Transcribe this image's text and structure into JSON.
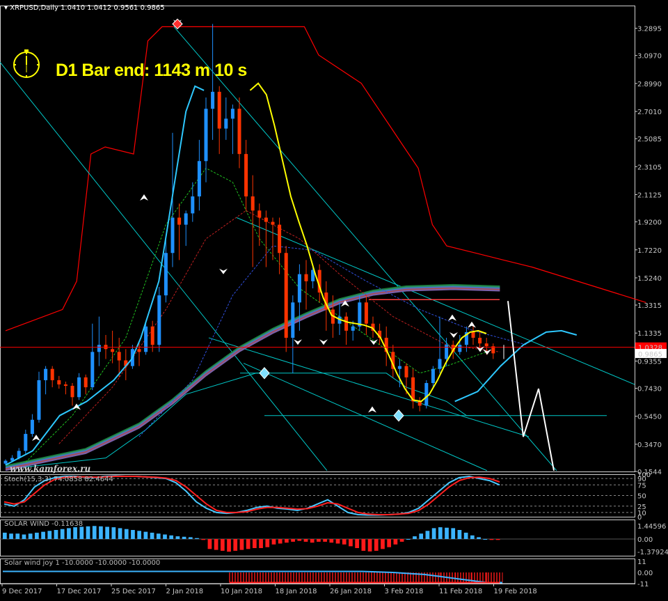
{
  "header": {
    "symbol": "XRPUSD,Daily",
    "ohlc": "1.0410 1.0412 0.9561 0.9865",
    "bar_timer": "D1 Bar end: 1143 m 10 s",
    "watermark": "www.kamforex.ru"
  },
  "colors": {
    "background": "#000000",
    "bull_candle": "#1e90ff",
    "bear_candle": "#ff3300",
    "ma_yellow": "#ffff00",
    "ma_cyan": "#2ec8ff",
    "envelope_red": "#ff0000",
    "trendline": "#00c8c8",
    "stoch_main": "#48c8ff",
    "stoch_signal": "#ff2020",
    "solar_pos": "#3cb4ff",
    "solar_neg": "#ff1a1a"
  },
  "chart_data": [
    {
      "type": "candlestick",
      "name": "price",
      "ylim": [
        0.1544,
        3.45
      ],
      "current_price_label": "1.0328",
      "bid_label": "0.9865",
      "y_ticks": [
        "3.2895",
        "3.0970",
        "2.8990",
        "2.7010",
        "2.5085",
        "2.3105",
        "2.1125",
        "1.9200",
        "1.7220",
        "1.5240",
        "1.3315",
        "1.1335",
        "0.9355",
        "0.7430",
        "0.5450",
        "0.3470",
        "0.1544"
      ],
      "x_ticks": [
        "9 Dec 2017",
        "17 Dec 2017",
        "25 Dec 2017",
        "2 Jan 2018",
        "10 Jan 2018",
        "18 Jan 2018",
        "26 Jan 2018",
        "3 Feb 2018",
        "11 Feb 2018",
        "19 Feb 2018"
      ],
      "candles": [
        [
          0.21,
          0.24,
          0.2,
          0.23
        ],
        [
          0.23,
          0.27,
          0.22,
          0.25
        ],
        [
          0.25,
          0.32,
          0.24,
          0.3
        ],
        [
          0.3,
          0.45,
          0.28,
          0.42
        ],
        [
          0.42,
          0.56,
          0.4,
          0.52
        ],
        [
          0.52,
          0.86,
          0.5,
          0.8
        ],
        [
          0.8,
          0.9,
          0.7,
          0.88
        ],
        [
          0.88,
          0.9,
          0.75,
          0.8
        ],
        [
          0.8,
          0.83,
          0.74,
          0.77
        ],
        [
          0.77,
          0.79,
          0.7,
          0.76
        ],
        [
          0.76,
          0.78,
          0.62,
          0.68
        ],
        [
          0.68,
          0.85,
          0.66,
          0.82
        ],
        [
          0.82,
          0.84,
          0.7,
          0.75
        ],
        [
          0.75,
          1.2,
          0.73,
          1.0
        ],
        [
          1.0,
          1.25,
          0.9,
          1.05
        ],
        [
          1.05,
          1.12,
          0.95,
          1.02
        ],
        [
          1.02,
          1.15,
          0.92,
          1.0
        ],
        [
          1.0,
          1.1,
          0.82,
          0.94
        ],
        [
          0.94,
          1.02,
          0.8,
          0.9
        ],
        [
          0.9,
          1.05,
          0.88,
          1.02
        ],
        [
          1.02,
          1.08,
          0.9,
          1.0
        ],
        [
          1.0,
          1.22,
          0.98,
          1.18
        ],
        [
          1.18,
          1.22,
          1.0,
          1.05
        ],
        [
          1.05,
          1.46,
          1.0,
          1.4
        ],
        [
          1.4,
          1.8,
          1.35,
          1.7
        ],
        [
          1.7,
          2.55,
          1.6,
          1.95
        ],
        [
          1.95,
          2.05,
          1.65,
          1.9
        ],
        [
          1.9,
          2.0,
          1.75,
          1.98
        ],
        [
          1.98,
          2.2,
          1.92,
          2.1
        ],
        [
          2.1,
          2.5,
          2.0,
          2.35
        ],
        [
          2.35,
          2.8,
          2.2,
          2.72
        ],
        [
          2.72,
          3.32,
          2.5,
          2.84
        ],
        [
          2.84,
          2.88,
          2.4,
          2.58
        ],
        [
          2.58,
          2.8,
          2.5,
          2.65
        ],
        [
          2.65,
          2.75,
          2.4,
          2.72
        ],
        [
          2.72,
          2.8,
          2.3,
          2.4
        ],
        [
          2.4,
          2.5,
          2.0,
          2.1
        ],
        [
          2.1,
          2.25,
          1.6,
          2.0
        ],
        [
          2.0,
          2.05,
          1.75,
          1.95
        ],
        [
          1.95,
          2.0,
          1.6,
          1.92
        ],
        [
          1.92,
          1.95,
          1.65,
          1.9
        ],
        [
          1.9,
          1.95,
          1.55,
          1.7
        ],
        [
          1.7,
          1.75,
          1.0,
          1.1
        ],
        [
          1.1,
          1.4,
          0.85,
          1.35
        ],
        [
          1.35,
          1.62,
          1.15,
          1.55
        ],
        [
          1.55,
          1.65,
          1.3,
          1.5
        ],
        [
          1.5,
          1.6,
          1.45,
          1.58
        ],
        [
          1.58,
          1.62,
          1.35,
          1.42
        ],
        [
          1.42,
          1.5,
          1.15,
          1.3
        ],
        [
          1.3,
          1.4,
          1.1,
          1.2
        ],
        [
          1.2,
          1.35,
          1.12,
          1.25
        ],
        [
          1.25,
          1.28,
          1.05,
          1.15
        ],
        [
          1.15,
          1.22,
          1.08,
          1.18
        ],
        [
          1.18,
          1.4,
          1.15,
          1.35
        ],
        [
          1.35,
          1.4,
          1.12,
          1.2
        ],
        [
          1.2,
          1.25,
          1.1,
          1.15
        ],
        [
          1.15,
          1.2,
          1.05,
          1.1
        ],
        [
          1.1,
          1.18,
          0.9,
          1.0
        ],
        [
          1.0,
          1.05,
          0.82,
          0.88
        ],
        [
          0.88,
          0.95,
          0.75,
          0.9
        ],
        [
          0.9,
          0.92,
          0.7,
          0.82
        ],
        [
          0.82,
          0.88,
          0.6,
          0.65
        ],
        [
          0.65,
          0.68,
          0.58,
          0.62
        ],
        [
          0.62,
          0.8,
          0.6,
          0.78
        ],
        [
          0.78,
          0.9,
          0.75,
          0.88
        ],
        [
          0.88,
          1.25,
          0.85,
          0.95
        ],
        [
          0.95,
          1.1,
          0.9,
          1.05
        ],
        [
          1.05,
          1.08,
          0.95,
          1.0
        ],
        [
          1.0,
          1.12,
          0.98,
          1.05
        ],
        [
          1.05,
          1.18,
          1.0,
          1.14
        ],
        [
          1.14,
          1.2,
          1.05,
          1.1
        ],
        [
          1.1,
          1.15,
          1.02,
          1.06
        ],
        [
          1.06,
          1.1,
          0.98,
          1.04
        ],
        [
          1.04,
          1.06,
          0.95,
          0.99
        ]
      ],
      "ma_yellow": [
        [
          30,
          2.85
        ],
        [
          31,
          2.9
        ],
        [
          32,
          2.82
        ],
        [
          33,
          2.6
        ],
        [
          34,
          2.35
        ],
        [
          35,
          2.1
        ],
        [
          36,
          1.92
        ],
        [
          37,
          1.75
        ],
        [
          38,
          1.55
        ],
        [
          39,
          1.38
        ],
        [
          40,
          1.26
        ],
        [
          41,
          1.23
        ],
        [
          42,
          1.21
        ],
        [
          43,
          1.2
        ],
        [
          44,
          1.19
        ],
        [
          45,
          1.17
        ],
        [
          46,
          1.1
        ],
        [
          47,
          0.98
        ],
        [
          48,
          0.85
        ],
        [
          49,
          0.74
        ],
        [
          50,
          0.66
        ],
        [
          51,
          0.65
        ],
        [
          52,
          0.7
        ],
        [
          53,
          0.8
        ],
        [
          54,
          0.92
        ],
        [
          55,
          1.02
        ],
        [
          56,
          1.1
        ],
        [
          57,
          1.14
        ],
        [
          58,
          1.15
        ],
        [
          59,
          1.13
        ]
      ],
      "ma_cyan": [
        [
          0,
          0.2
        ],
        [
          3,
          0.3
        ],
        [
          6,
          0.55
        ],
        [
          9,
          0.65
        ],
        [
          12,
          0.8
        ],
        [
          14,
          0.95
        ],
        [
          15,
          1.1
        ],
        [
          17,
          1.5
        ],
        [
          18,
          1.9
        ],
        [
          19,
          2.3
        ],
        [
          20,
          2.7
        ],
        [
          21,
          2.88
        ],
        [
          22,
          2.85
        ]
      ],
      "upper_red_band": [
        [
          0,
          1.15
        ],
        [
          4,
          1.3
        ],
        [
          5,
          1.5
        ],
        [
          6,
          2.4
        ],
        [
          7,
          2.45
        ],
        [
          9,
          2.4
        ],
        [
          10,
          3.2
        ],
        [
          11,
          3.3
        ],
        [
          21,
          3.3
        ],
        [
          22,
          3.1
        ],
        [
          25,
          2.9
        ],
        [
          27,
          2.6
        ],
        [
          28,
          2.45
        ],
        [
          29,
          2.3
        ],
        [
          30,
          1.9
        ],
        [
          31,
          1.75
        ],
        [
          33,
          1.7
        ],
        [
          35,
          1.65
        ],
        [
          37,
          1.6
        ],
        [
          45,
          1.35
        ]
      ],
      "sell_arrow_levels": [
        3.32,
        1.55,
        1.05,
        1.05,
        1.05,
        1.0,
        1.1,
        0.98
      ],
      "buy_arrow_levels": [
        0.4,
        2.1,
        0.62,
        0.6,
        1.35,
        1.25,
        1.2
      ]
    },
    {
      "type": "line",
      "name": "stochastic",
      "label": "Stoch(15,3,3) 74.0858 82.4644",
      "ylim": [
        0,
        100
      ],
      "y_ticks": [
        "100",
        "90",
        "75",
        "50",
        "25",
        "10",
        "0"
      ],
      "x_ticks": [
        "9 Dec 2017",
        "17 Dec 2017",
        "25 Dec 2017",
        "2 Jan 2018",
        "10 Jan 2018",
        "18 Jan 2018",
        "26 Jan 2018",
        "3 Feb 2018",
        "11 Feb 2018",
        "19 Feb 2018"
      ],
      "series": [
        {
          "values": [
            30,
            25,
            40,
            70,
            85,
            92,
            95,
            95,
            93,
            92,
            95,
            96,
            95,
            95,
            94,
            92,
            90,
            80,
            60,
            35,
            20,
            10,
            8,
            10,
            15,
            22,
            25,
            20,
            18,
            15,
            20,
            30,
            40,
            25,
            10,
            5,
            4,
            4,
            5,
            6,
            10,
            20,
            40,
            60,
            80,
            92,
            95,
            90,
            85,
            75
          ]
        },
        {
          "values": [
            35,
            30,
            35,
            55,
            75,
            88,
            93,
            94,
            94,
            93,
            94,
            95,
            95,
            95,
            94,
            93,
            91,
            85,
            70,
            50,
            30,
            15,
            10,
            10,
            12,
            18,
            22,
            22,
            20,
            18,
            19,
            25,
            33,
            30,
            20,
            10,
            6,
            5,
            5,
            6,
            8,
            15,
            30,
            50,
            70,
            85,
            92,
            93,
            90,
            82
          ]
        }
      ]
    },
    {
      "type": "bar",
      "name": "solar wind",
      "label": "SOLAR WIND -0.11638",
      "ylim": [
        -2.0,
        2.0
      ],
      "y_ticks": [
        "1.44596",
        "0.00",
        "-1.37924"
      ],
      "values": [
        0.7,
        0.6,
        0.6,
        0.5,
        0.6,
        0.7,
        0.8,
        0.9,
        1.0,
        1.1,
        1.2,
        1.3,
        1.35,
        1.4,
        1.44,
        1.4,
        1.35,
        1.3,
        1.2,
        1.1,
        1.0,
        0.9,
        0.8,
        0.7,
        0.6,
        0.5,
        0.4,
        0.3,
        0.25,
        0.2,
        0.1,
        -0.1,
        -1.1,
        -1.2,
        -1.3,
        -1.4,
        -1.3,
        -1.2,
        -1.1,
        -1.0,
        -1.0,
        -0.9,
        -0.6,
        -0.5,
        -0.4,
        -0.3,
        -0.2,
        -0.3,
        -0.4,
        -0.3,
        -0.3,
        -0.4,
        -0.5,
        -0.6,
        -0.8,
        -1.0,
        -1.3,
        -1.37,
        -1.3,
        -1.1,
        -0.9,
        -0.6,
        -0.3,
        0.0,
        0.3,
        0.6,
        0.9,
        1.2,
        1.3,
        1.25,
        1.2,
        1.0,
        0.7,
        0.4,
        0.2,
        0.0,
        -0.1,
        -0.1
      ]
    },
    {
      "type": "bar",
      "name": "solar wind joy",
      "label": "Solar wind joy 1 -10.0000 -10.0000 -10.0000",
      "ylim": [
        -11,
        11
      ],
      "y_ticks": [
        "11",
        "0.00",
        "-11"
      ],
      "line_values": [
        1,
        1,
        1,
        1,
        1,
        1,
        1,
        1,
        1,
        1,
        1,
        1,
        1,
        1,
        1,
        1,
        1,
        1,
        1,
        1,
        1,
        1,
        1,
        1,
        0.5,
        0,
        -1,
        -2,
        -4,
        -6,
        -8,
        -10,
        -10
      ],
      "bar_values_neg": -10
    }
  ]
}
